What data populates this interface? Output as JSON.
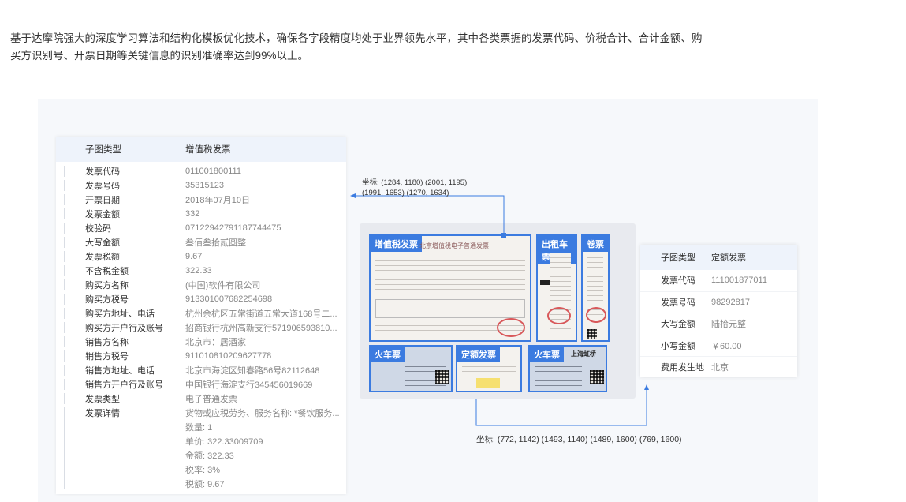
{
  "intro": {
    "line1": "基于达摩院强大的深度学习算法和结构化模板优化技术，确保各字段精度均处于业界领先水平，其中各类票据的发票代码、价税合计、合计金额、购",
    "line2": "买方识别号、开票日期等关键信息的识别准确率达到99%以上。"
  },
  "left_card": {
    "header_key": "子图类型",
    "header_value": "增值税发票",
    "rows": [
      {
        "k": "发票代码",
        "v": "011001800111"
      },
      {
        "k": "发票号码",
        "v": "35315123"
      },
      {
        "k": "开票日期",
        "v": "2018年07月10日"
      },
      {
        "k": "发票金额",
        "v": "332"
      },
      {
        "k": "校验码",
        "v": "07122942791187744475"
      },
      {
        "k": "大写金额",
        "v": "叁佰叁拾贰圆整"
      },
      {
        "k": "发票税额",
        "v": "9.67"
      },
      {
        "k": "不含税金额",
        "v": "322.33"
      },
      {
        "k": "购买方名称",
        "v": "(中国)软件有限公司"
      },
      {
        "k": "购买方税号",
        "v": "913301007682254698"
      },
      {
        "k": "购买方地址、电话",
        "v": "杭州余杭区五常街道五常大道168号二..."
      },
      {
        "k": "购买方开户行及账号",
        "v": "招商银行杭州高新支行571906593810..."
      },
      {
        "k": "销售方名称",
        "v": "北京市：居酒家"
      },
      {
        "k": "销售方税号",
        "v": "911010810209627778"
      },
      {
        "k": "销售方地址、电话",
        "v": "北京市海淀区知春路56号82112648"
      },
      {
        "k": "销售方开户行及账号",
        "v": "中国银行海淀支行345456019669"
      },
      {
        "k": "发票类型",
        "v": "电子普通发票"
      },
      {
        "k": "发票详情",
        "v": "货物或应税劳务、服务名称: *餐饮服务..."
      }
    ],
    "detail_lines": [
      "数量: 1",
      "单价: 322.33009709",
      "金额: 322.33",
      "税率: 3%",
      "税额: 9.67"
    ]
  },
  "right_card": {
    "header_key": "子图类型",
    "header_value": "定额发票",
    "rows": [
      {
        "k": "发票代码",
        "v": "111001877011"
      },
      {
        "k": "发票号码",
        "v": "98292817"
      },
      {
        "k": "大写金额",
        "v": "陆拾元整"
      },
      {
        "k": "小写金额",
        "v": "￥60.00"
      },
      {
        "k": "费用发生地",
        "v": "北京"
      }
    ]
  },
  "collage": {
    "vat_tag": "增值税发票",
    "vat_title": "北京增值税电子普通发票",
    "taxi_tag": "出租车票",
    "roll_tag": "卷票",
    "train1_tag": "火车票",
    "fixed_tag": "定额发票",
    "train2_tag": "火车票",
    "train_station": "上海虹桥"
  },
  "coords": {
    "top_line1": "坐标: (1284, 1180) (2001, 1195)",
    "top_line2": "(1991, 1653) (1270, 1634)",
    "bottom": "坐标: (772, 1142) (1493, 1140) (1489, 1600) (769, 1600)"
  },
  "colors": {
    "accent": "#3b7be0",
    "stamp": "#d8585a",
    "header_bg": "#eef3fb"
  }
}
